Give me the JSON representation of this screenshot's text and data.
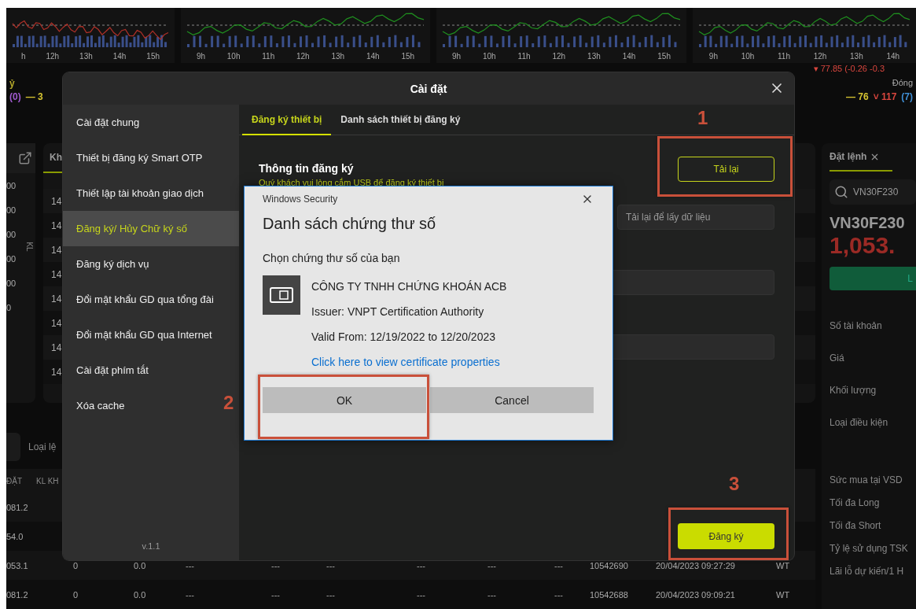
{
  "charts": [
    {
      "color": "#b03028",
      "hours": [
        "h",
        "12h",
        "13h",
        "14h",
        "15h"
      ]
    },
    {
      "color": "#1f8f1f",
      "hours": [
        "9h",
        "10h",
        "11h",
        "12h",
        "13h",
        "14h",
        "15h"
      ]
    },
    {
      "color": "#1f8f1f",
      "hours": [
        "9h",
        "10h",
        "11h",
        "12h",
        "13h",
        "14h",
        "15h"
      ]
    },
    {
      "color": "#1f8f1f",
      "hours": [
        "9h",
        "10h",
        "11h",
        "12h",
        "13h",
        "14h"
      ]
    }
  ],
  "ticker": {
    "right_change": "▾ 77.85 (-0.26 -0.3",
    "left_note": "ỷ",
    "left_counts": [
      {
        "text": "(0)",
        "color": "#a05ad0"
      },
      {
        "text": "— 3",
        "color": "#d6c431"
      }
    ],
    "right_status": "Đóng",
    "right_counts": [
      {
        "text": "— 76",
        "color": "#d6c431"
      },
      {
        "text": "˅ 117",
        "color": "#d9463e"
      },
      {
        "text": "(7)",
        "color": "#3f8fd6"
      }
    ]
  },
  "depth_panel": {
    "values": [
      "00",
      "00",
      "00",
      "00",
      "00",
      "0"
    ],
    "axis_label": "KL"
  },
  "trades_panel": {
    "tab": "Kh",
    "rows": [
      "14",
      "14",
      "14",
      "14",
      "14",
      "14",
      "14",
      "14"
    ]
  },
  "orders": {
    "filter_label": "Loại lệ",
    "columns": [
      "ĐẶT",
      "KL KH"
    ],
    "rows": [
      {
        "cells": [
          "081.2"
        ]
      },
      {
        "cells": [
          "54.0"
        ]
      },
      {
        "cells": [
          "053.1",
          "0",
          "0.0",
          "---",
          "---",
          "---",
          "---",
          "---",
          "---",
          "10542690",
          "20/04/2023 09:27:29",
          "WT"
        ]
      },
      {
        "cells": [
          "081.2",
          "0",
          "0.0",
          "---",
          "---",
          "---",
          "---",
          "---",
          "---",
          "10542688",
          "20/04/2023 09:09:21",
          "WT"
        ]
      }
    ]
  },
  "order_panel": {
    "tab": "Đặt lệnh",
    "search_value": "VN30F230",
    "symbol": "VN30F230",
    "price": "1,053.",
    "action": "L",
    "labels": [
      "Số tài khoản",
      "Giá",
      "Khối lượng",
      "Loại điều kiện"
    ],
    "summary": [
      "Sức mua tại VSD",
      "Tối đa Long",
      "Tối đa Short",
      "Tỷ lệ sử dụng TSK",
      "Lãi lỗ dự kiến/1 H"
    ]
  },
  "settings": {
    "title": "Cài đặt",
    "menu": [
      {
        "label": "Cài đặt chung",
        "selected": false
      },
      {
        "label": "Thiết bị đăng ký Smart OTP",
        "selected": false
      },
      {
        "label": "Thiết lập tài khoản giao dịch",
        "selected": false
      },
      {
        "label": "Đăng ký/ Hủy Chữ ký số",
        "selected": true
      },
      {
        "label": "Đăng ký dịch vụ",
        "selected": false
      },
      {
        "label": "Đổi mật khẩu GD qua tổng đài",
        "selected": false
      },
      {
        "label": "Đổi mật khẩu GD qua Internet",
        "selected": false
      },
      {
        "label": "Cài đặt phím tắt",
        "selected": false
      },
      {
        "label": "Xóa cache",
        "selected": false
      }
    ],
    "version": "v.1.1",
    "tabs": [
      {
        "label": "Đăng ký thiết bị",
        "selected": true
      },
      {
        "label": "Danh sách thiết bị đăng ký",
        "selected": false
      }
    ],
    "section_title": "Thông tin đăng ký",
    "section_hint": "Quý khách vui lòng cắm USB để đăng ký thiết bị",
    "reload_button": "Tải lại",
    "device_field": {
      "placeholder": "Tải lại để lấy dữ liệu"
    },
    "register_button": "Đăng ký"
  },
  "security_dialog": {
    "caption": "Windows Security",
    "title": "Danh sách chứng thư số",
    "prompt": "Chọn chứng thư số của bạn",
    "certificate": {
      "subject": "CÔNG TY TNHH CHỨNG KHOÁN ACB",
      "issuer": "Issuer: VNPT Certification Authority",
      "validity": "Valid From: 12/19/2022 to 12/20/2023",
      "link": "Click here to view certificate properties"
    },
    "buttons": [
      "OK",
      "Cancel"
    ]
  },
  "annotations": [
    {
      "label": "1"
    },
    {
      "label": "2"
    },
    {
      "label": "3"
    }
  ]
}
